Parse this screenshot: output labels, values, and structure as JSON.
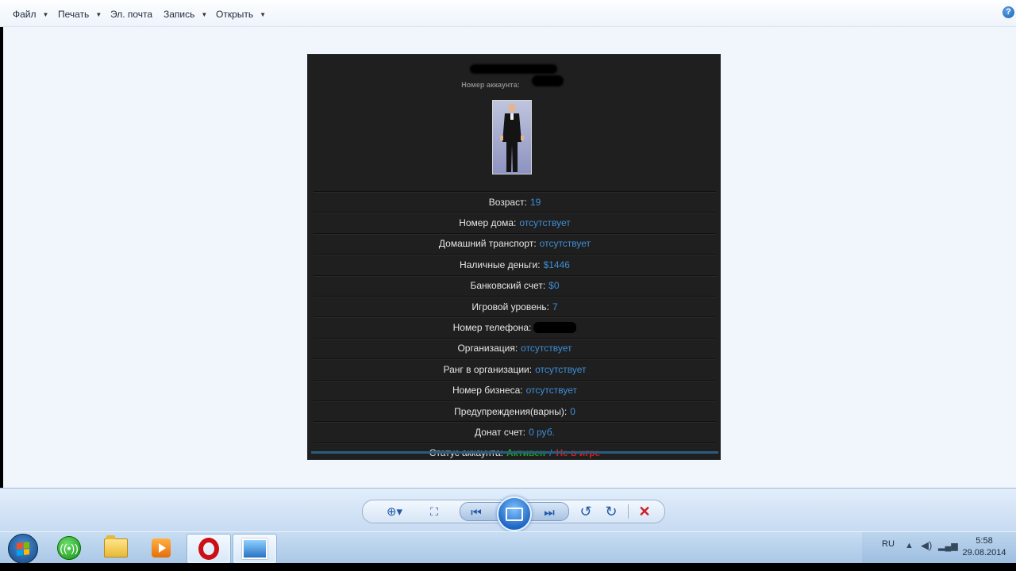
{
  "menubar": {
    "items": [
      {
        "label": "Файл",
        "has_dropdown": true
      },
      {
        "label": "Печать",
        "has_dropdown": true
      },
      {
        "label": "Эл. почта",
        "has_dropdown": false
      },
      {
        "label": "Запись",
        "has_dropdown": true
      },
      {
        "label": "Открыть",
        "has_dropdown": true
      }
    ],
    "help_icon": "help-icon"
  },
  "profile": {
    "account_number_label": "Номер аккаунта:",
    "avatar_icon": "character-avatar",
    "rows": [
      {
        "label": "Возраст:",
        "value": "19"
      },
      {
        "label": "Номер дома:",
        "value": "отсутствует"
      },
      {
        "label": "Домашний транспорт:",
        "value": "отсутствует"
      },
      {
        "label": "Наличные деньги:",
        "value": "$1446"
      },
      {
        "label": "Банковский счет:",
        "value": "$0"
      },
      {
        "label": "Игровой уровень:",
        "value": "7"
      },
      {
        "label": "Номер телефона:",
        "value": ""
      },
      {
        "label": "Организация:",
        "value": "отсутствует"
      },
      {
        "label": "Ранг в организации:",
        "value": "отсутствует"
      },
      {
        "label": "Номер бизнеса:",
        "value": "отсутствует"
      },
      {
        "label": "Предупреждения(варны):",
        "value": "0"
      },
      {
        "label": "Донат счет:",
        "value": "0 руб."
      }
    ],
    "status": {
      "label": "Статус аккаунта:",
      "active": "Активен",
      "separator": "/",
      "offline": "Не в игре"
    },
    "colors": {
      "value": "#3e8ed6",
      "active": "#19a319",
      "offline": "#e11a1a",
      "panel": "#1f1f1f"
    }
  },
  "controls": {
    "zoom": "⊕▾",
    "fit": "⛶",
    "prev": "⏮",
    "next": "⏭",
    "rotate_ccw": "↺",
    "rotate_cw": "↻",
    "delete": "✕"
  },
  "taskbar": {
    "language": "RU",
    "time": "5:58",
    "date": "29.08.2014",
    "apps": [
      "network-manager-icon",
      "folder-icon",
      "media-player-icon",
      "opera-icon",
      "photo-viewer-icon"
    ]
  }
}
